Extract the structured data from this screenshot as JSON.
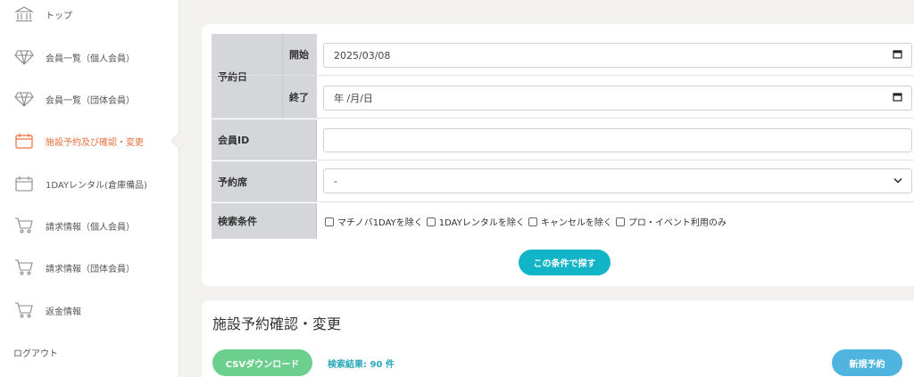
{
  "sidebar": {
    "items": [
      {
        "label": "トップ",
        "icon": "bank-icon"
      },
      {
        "label": "会員一覧（個人会員）",
        "icon": "diamond-icon"
      },
      {
        "label": "会員一覧（団体会員）",
        "icon": "diamond-icon"
      },
      {
        "label": "施設予約及び確認・変更",
        "icon": "calendar-icon",
        "active": true
      },
      {
        "label": "1DAYレンタル(倉庫備品)",
        "icon": "calendar-icon"
      },
      {
        "label": "請求情報（個人会員）",
        "icon": "cart-icon"
      },
      {
        "label": "請求情報（団体会員）",
        "icon": "cart-icon"
      },
      {
        "label": "返金情報",
        "icon": "cart-icon"
      }
    ],
    "logout": "ログアウト"
  },
  "form": {
    "date_label": "予約日",
    "start_label": "開始",
    "start_value": "2025/03/08",
    "end_label": "終了",
    "end_value": "年 /月/日",
    "member_id_label": "会員ID",
    "member_id_value": "",
    "seat_label": "予約席",
    "seat_value": "-",
    "conditions_label": "検索条件",
    "checks": [
      "マチノバ1DAYを除く",
      "1DAYレンタルを除く",
      "キャンセルを除く",
      "プロ・イベント利用のみ"
    ],
    "search_button": "この条件で探す"
  },
  "results": {
    "title": "施設予約確認・変更",
    "csv_button": "CSVダウンロード",
    "count_text": "検索結果: 90 件",
    "new_button": "新規予約"
  },
  "colors": {
    "accent_active": "#e9703d",
    "search_button": "#12b4c8",
    "csv_button": "#6ccf8d",
    "new_button": "#4fb5de"
  }
}
